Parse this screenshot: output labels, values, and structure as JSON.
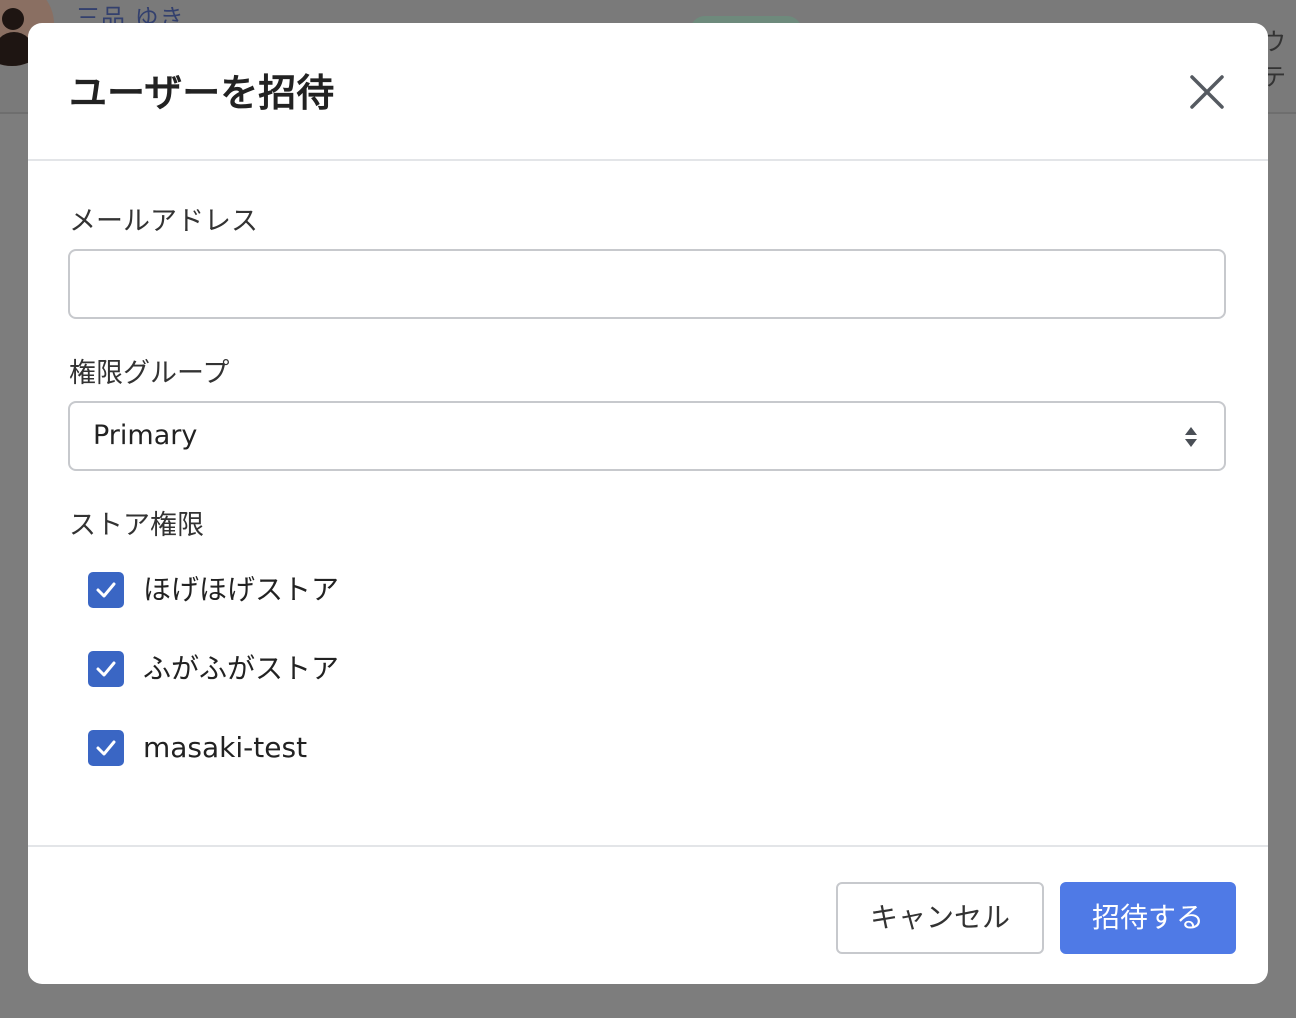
{
  "background": {
    "user_name": "三品 ゆき",
    "right_text": "ウテ"
  },
  "modal": {
    "title": "ユーザーを招待",
    "close_icon": "close-icon",
    "email": {
      "label": "メールアドレス",
      "value": "",
      "placeholder": ""
    },
    "role_group": {
      "label": "権限グループ",
      "selected": "Primary",
      "icon": "select-arrows-icon"
    },
    "store_permissions": {
      "label": "ストア権限",
      "items": [
        {
          "label": "ほげほげストア",
          "checked": true
        },
        {
          "label": "ふがふがストア",
          "checked": true
        },
        {
          "label": "masaki-test",
          "checked": true
        }
      ]
    },
    "footer": {
      "cancel_label": "キャンセル",
      "submit_label": "招待する"
    }
  },
  "colors": {
    "overlay": "#7d7d7d",
    "primary": "#4f7ae6",
    "checkbox": "#3a66c4",
    "border": "#c7c9cd"
  }
}
